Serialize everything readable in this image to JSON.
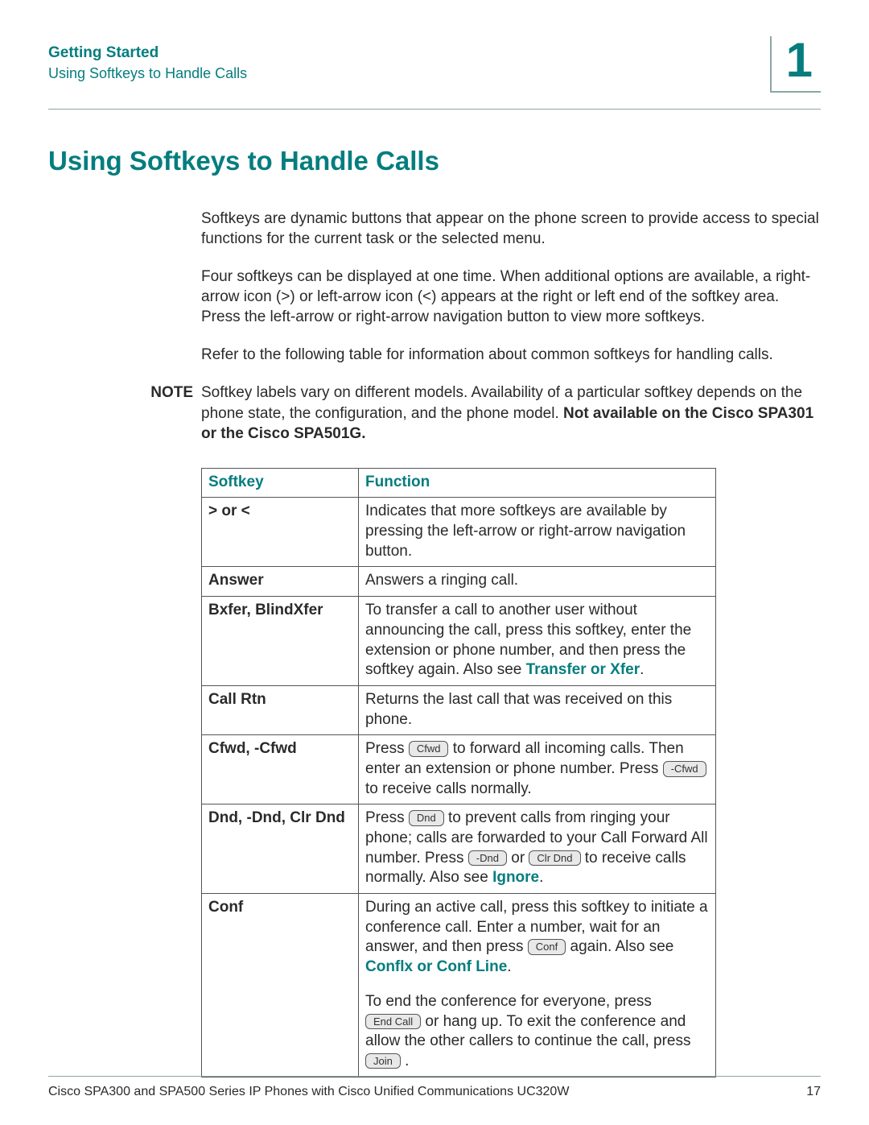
{
  "header": {
    "chapter_title": "Getting Started",
    "section_title": "Using Softkeys to Handle Calls",
    "chapter_number": "1"
  },
  "heading": "Using Softkeys to Handle Calls",
  "paragraphs": {
    "p1": "Softkeys are dynamic buttons that appear on the phone screen to provide access to special functions for the current task or the selected menu.",
    "p2": "Four softkeys can be displayed at one time. When additional options are available, a right-arrow icon (>) or left-arrow icon (<) appears at the right or left end of the softkey area. Press the left-arrow or right-arrow navigation button to view more softkeys.",
    "p3": "Refer to the following table for information about common softkeys for handling calls."
  },
  "note": {
    "label": "NOTE",
    "text_a": "Softkey labels vary on different models. Availability of a particular softkey depends on the phone state, the configuration, and the phone model. ",
    "text_bold": "Not available on the Cisco SPA301 or the Cisco SPA501G."
  },
  "table": {
    "head_softkey": "Softkey",
    "head_function": "Function",
    "rows": {
      "arrows": {
        "key": "> or <",
        "func": "Indicates that more softkeys are available by pressing the left-arrow or right-arrow navigation button."
      },
      "answer": {
        "key": "Answer",
        "func": "Answers a ringing call."
      },
      "bxfer": {
        "key": "Bxfer, BlindXfer",
        "func_a": "To transfer a call to another user without announcing the call, press this softkey, enter the extension or phone number, and then press the softkey again. Also see ",
        "link": "Transfer or Xfer",
        "func_b": "."
      },
      "callrtn": {
        "key": "Call Rtn",
        "func": "Returns the last call that was received on this phone."
      },
      "cfwd": {
        "key": "Cfwd, -Cfwd",
        "t1": "Press ",
        "btn1": "Cfwd",
        "t2": " to forward all incoming calls. Then enter an extension or phone number. Press ",
        "btn2": "-Cfwd",
        "t3": " to receive calls normally."
      },
      "dnd": {
        "key": "Dnd, -Dnd, Clr Dnd",
        "t1": "Press ",
        "btn1": "Dnd",
        "t2": " to prevent calls from ringing your phone; calls are forwarded to your Call Forward All number. Press ",
        "btn2": "-Dnd",
        "t3": " or ",
        "btn3": "Clr Dnd",
        "t4": " to receive calls normally. Also see ",
        "link": "Ignore",
        "t5": "."
      },
      "conf": {
        "key": "Conf",
        "t1": "During an active call, press this softkey to initiate a conference call. Enter a number, wait for an answer, and then press ",
        "btn1": "Conf",
        "t2": " again. Also see ",
        "link": "Conflx or Conf Line",
        "t3": ".",
        "t4": "To end the conference for everyone, press ",
        "btn2": "End Call",
        "t5": " or hang up. To exit the conference and allow the other callers to continue the call, press ",
        "btn3": "Join",
        "t6": " ."
      }
    }
  },
  "footer": {
    "doc_title": "Cisco SPA300 and SPA500 Series IP Phones with Cisco Unified Communications UC320W",
    "page_number": "17"
  }
}
